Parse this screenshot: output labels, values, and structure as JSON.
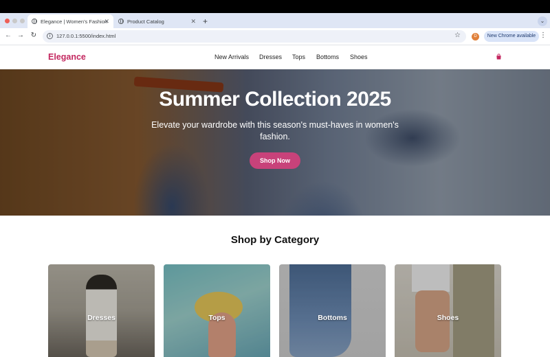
{
  "browser": {
    "tabs": [
      {
        "title": "Elegance | Women's Fashion",
        "active": true
      },
      {
        "title": "Product Catalog",
        "active": false
      }
    ],
    "new_tab_symbol": "+",
    "address": "127.0.0.1:5500/index.html",
    "profile_initial": "D",
    "update_label": "New Chrome available"
  },
  "site": {
    "logo": "Elegance",
    "nav": [
      "New Arrivals",
      "Dresses",
      "Tops",
      "Bottoms",
      "Shoes"
    ],
    "cart_icon": "shopping-bag-icon",
    "brand_color": "#c3275f"
  },
  "hero": {
    "title": "Summer Collection 2025",
    "subtitle": "Elevate your wardrobe with this season's must-haves in women's fashion.",
    "cta": "Shop Now",
    "cta_color": "#c8427a"
  },
  "categories": {
    "heading": "Shop by Category",
    "items": [
      "Dresses",
      "Tops",
      "Bottoms",
      "Shoes"
    ]
  }
}
